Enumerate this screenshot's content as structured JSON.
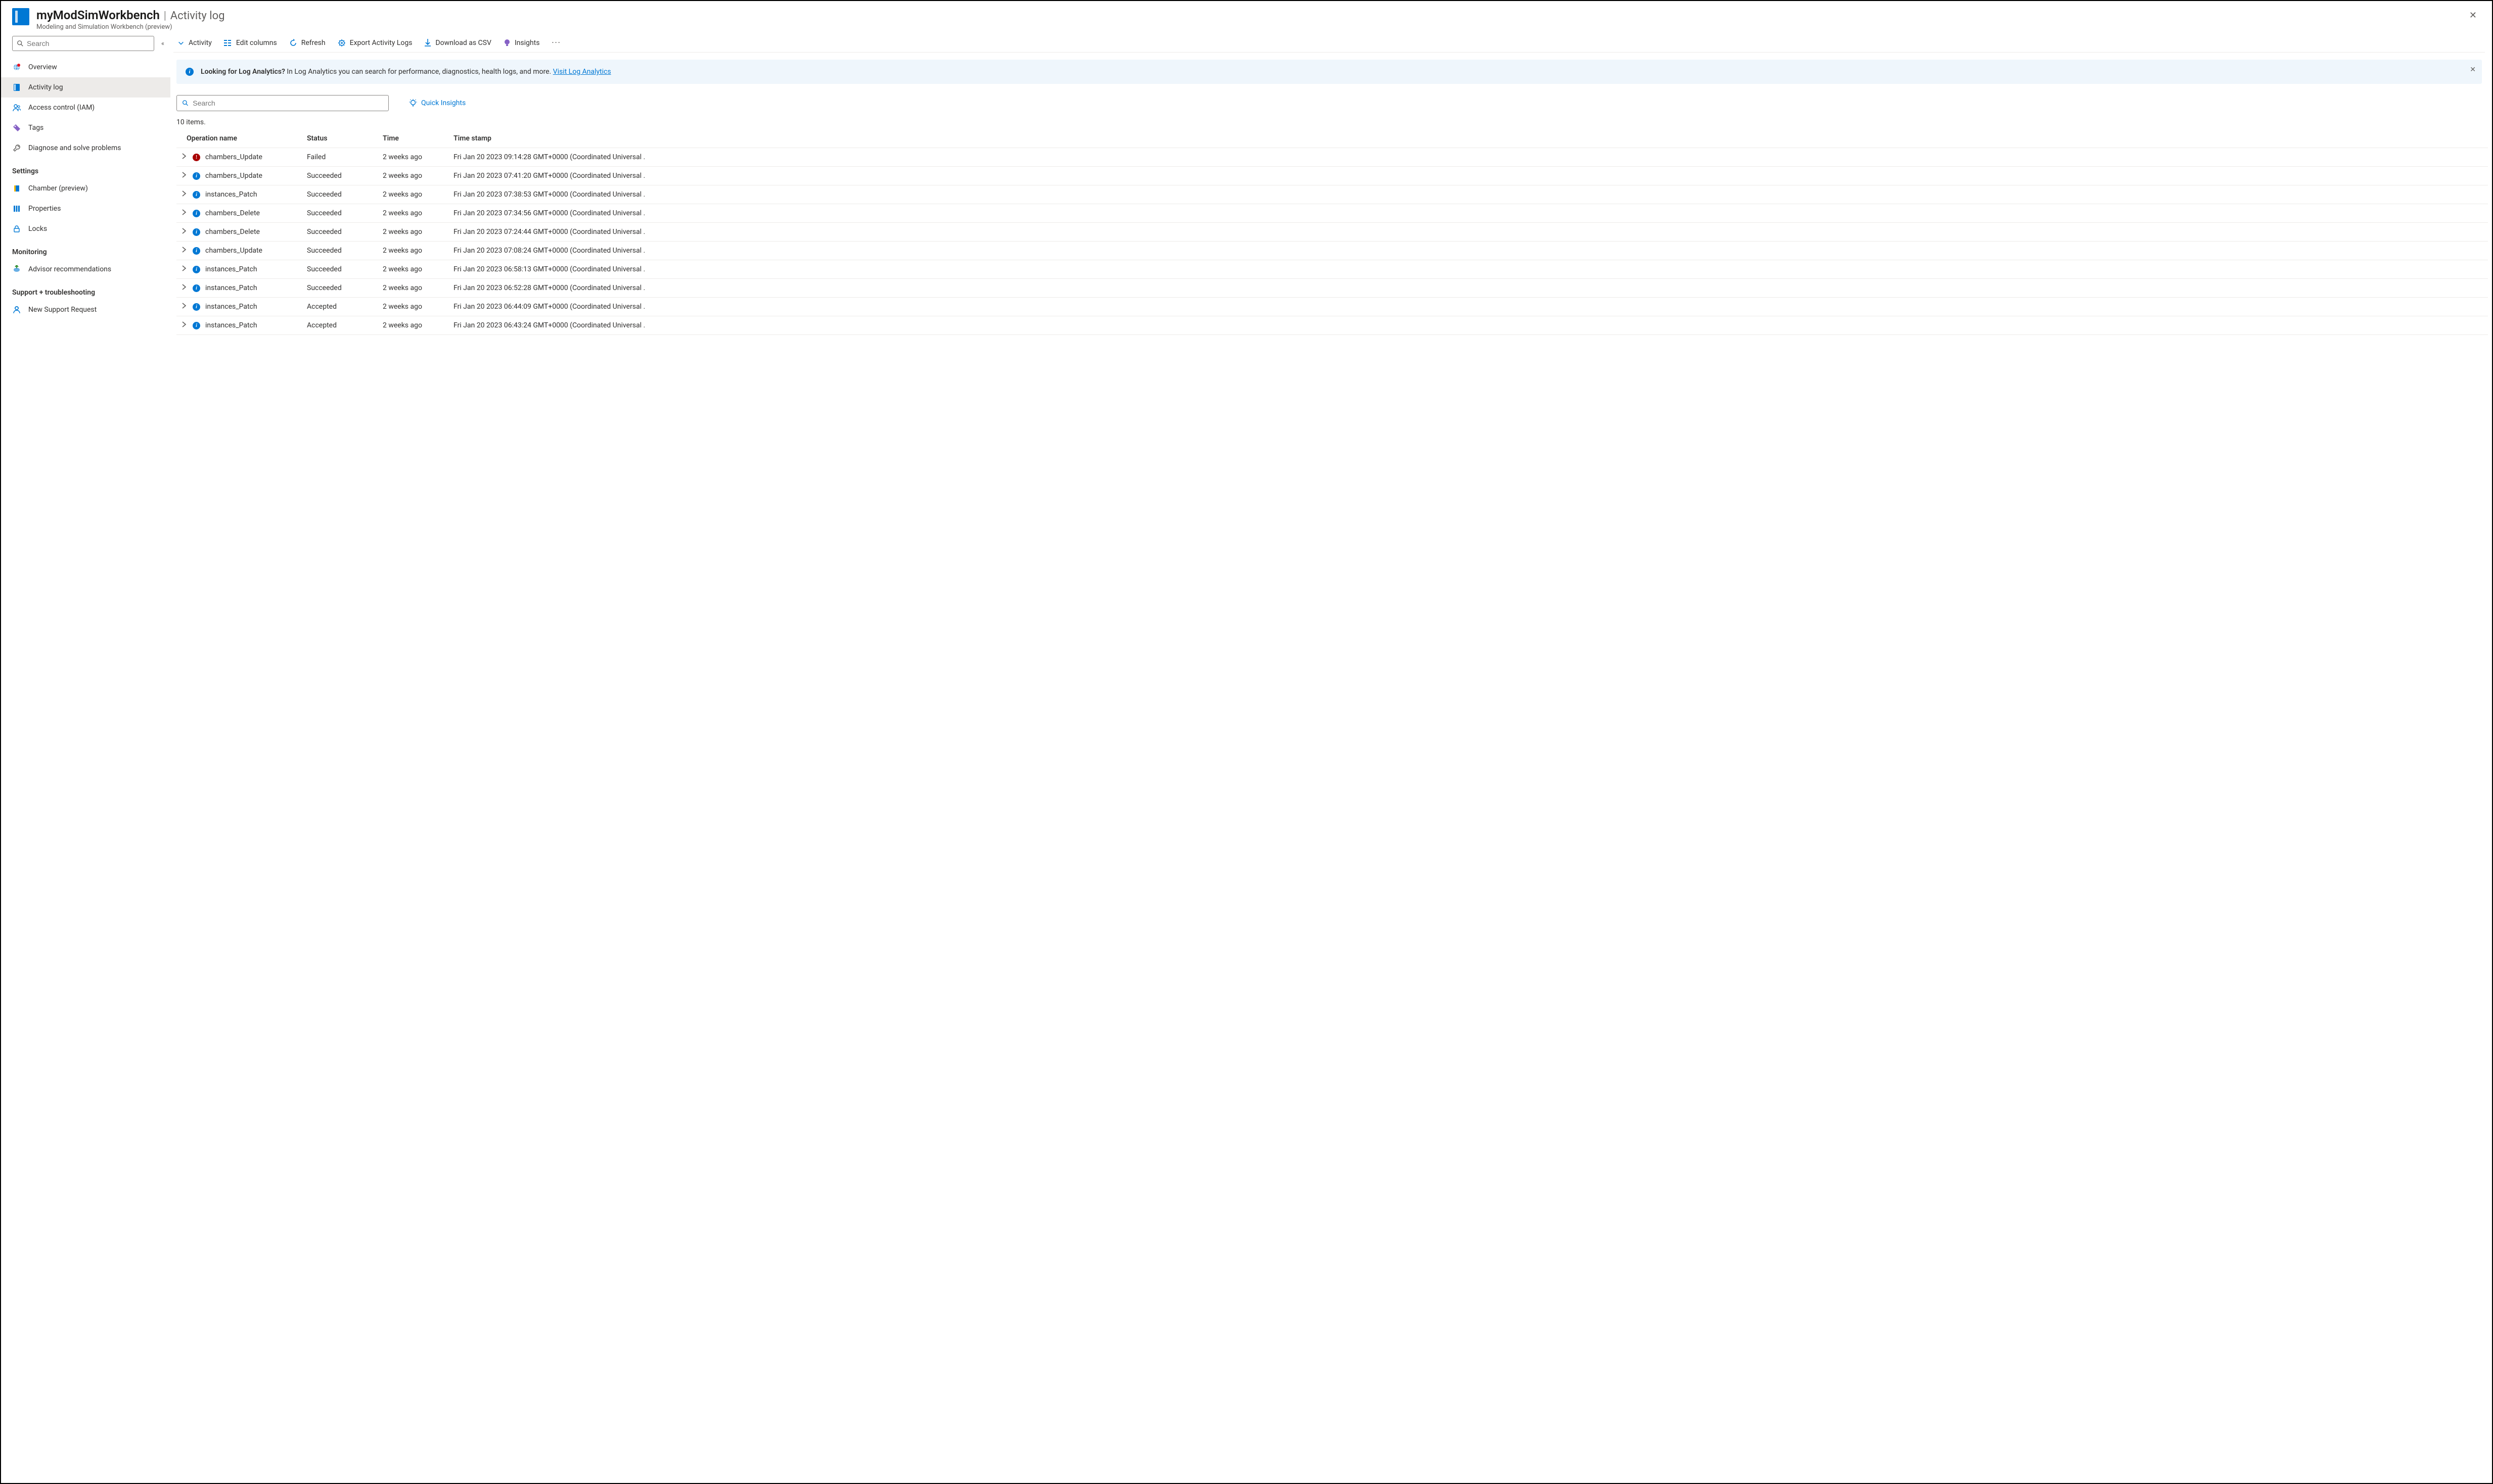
{
  "header": {
    "title": "myModSimWorkbench",
    "separator": "|",
    "page": "Activity log",
    "subtitle": "Modeling and Simulation Workbench (preview)"
  },
  "sidebar": {
    "search_placeholder": "Search",
    "items_top": [
      {
        "label": "Overview",
        "icon": "globe"
      },
      {
        "label": "Activity log",
        "icon": "log",
        "selected": true
      },
      {
        "label": "Access control (IAM)",
        "icon": "people"
      },
      {
        "label": "Tags",
        "icon": "tag"
      },
      {
        "label": "Diagnose and solve problems",
        "icon": "wrench"
      }
    ],
    "sections": [
      {
        "title": "Settings",
        "items": [
          {
            "label": "Chamber (preview)",
            "icon": "chamber"
          },
          {
            "label": "Properties",
            "icon": "properties"
          },
          {
            "label": "Locks",
            "icon": "lock"
          }
        ]
      },
      {
        "title": "Monitoring",
        "items": [
          {
            "label": "Advisor recommendations",
            "icon": "advisor"
          }
        ]
      },
      {
        "title": "Support + troubleshooting",
        "items": [
          {
            "label": "New Support Request",
            "icon": "support"
          }
        ]
      }
    ]
  },
  "toolbar": {
    "activity": "Activity",
    "edit_columns": "Edit columns",
    "refresh": "Refresh",
    "export": "Export Activity Logs",
    "download_csv": "Download as CSV",
    "insights": "Insights"
  },
  "banner": {
    "strong": "Looking for Log Analytics?",
    "text": " In Log Analytics you can search for performance, diagnostics, health logs, and more. ",
    "link": "Visit Log Analytics"
  },
  "search2_placeholder": "Search",
  "quick_insights": "Quick Insights",
  "item_count": "10 items.",
  "table": {
    "headers": {
      "op": "Operation name",
      "status": "Status",
      "time": "Time",
      "timestamp": "Time stamp"
    },
    "rows": [
      {
        "op": "chambers_Update",
        "status": "Failed",
        "status_kind": "err",
        "time": "2 weeks ago",
        "timestamp": "Fri Jan 20 2023 09:14:28 GMT+0000 (Coordinated Universal ."
      },
      {
        "op": "chambers_Update",
        "status": "Succeeded",
        "status_kind": "info",
        "time": "2 weeks ago",
        "timestamp": "Fri Jan 20 2023 07:41:20 GMT+0000 (Coordinated Universal ."
      },
      {
        "op": "instances_Patch",
        "status": "Succeeded",
        "status_kind": "info",
        "time": "2 weeks ago",
        "timestamp": "Fri Jan 20 2023 07:38:53 GMT+0000 (Coordinated Universal ."
      },
      {
        "op": "chambers_Delete",
        "status": "Succeeded",
        "status_kind": "info",
        "time": "2 weeks ago",
        "timestamp": "Fri Jan 20 2023 07:34:56 GMT+0000 (Coordinated Universal ."
      },
      {
        "op": "chambers_Delete",
        "status": "Succeeded",
        "status_kind": "info",
        "time": "2 weeks ago",
        "timestamp": "Fri Jan 20 2023 07:24:44 GMT+0000 (Coordinated Universal ."
      },
      {
        "op": "chambers_Update",
        "status": "Succeeded",
        "status_kind": "info",
        "time": "2 weeks ago",
        "timestamp": "Fri Jan 20 2023 07:08:24 GMT+0000 (Coordinated Universal ."
      },
      {
        "op": "instances_Patch",
        "status": "Succeeded",
        "status_kind": "info",
        "time": "2 weeks ago",
        "timestamp": "Fri Jan 20 2023 06:58:13 GMT+0000 (Coordinated Universal ."
      },
      {
        "op": "instances_Patch",
        "status": "Succeeded",
        "status_kind": "info",
        "time": "2 weeks ago",
        "timestamp": "Fri Jan 20 2023 06:52:28 GMT+0000 (Coordinated Universal ."
      },
      {
        "op": "instances_Patch",
        "status": "Accepted",
        "status_kind": "info",
        "time": "2 weeks ago",
        "timestamp": "Fri Jan 20 2023 06:44:09 GMT+0000 (Coordinated Universal ."
      },
      {
        "op": "instances_Patch",
        "status": "Accepted",
        "status_kind": "info",
        "time": "2 weeks ago",
        "timestamp": "Fri Jan 20 2023 06:43:24 GMT+0000 (Coordinated Universal ."
      }
    ]
  }
}
